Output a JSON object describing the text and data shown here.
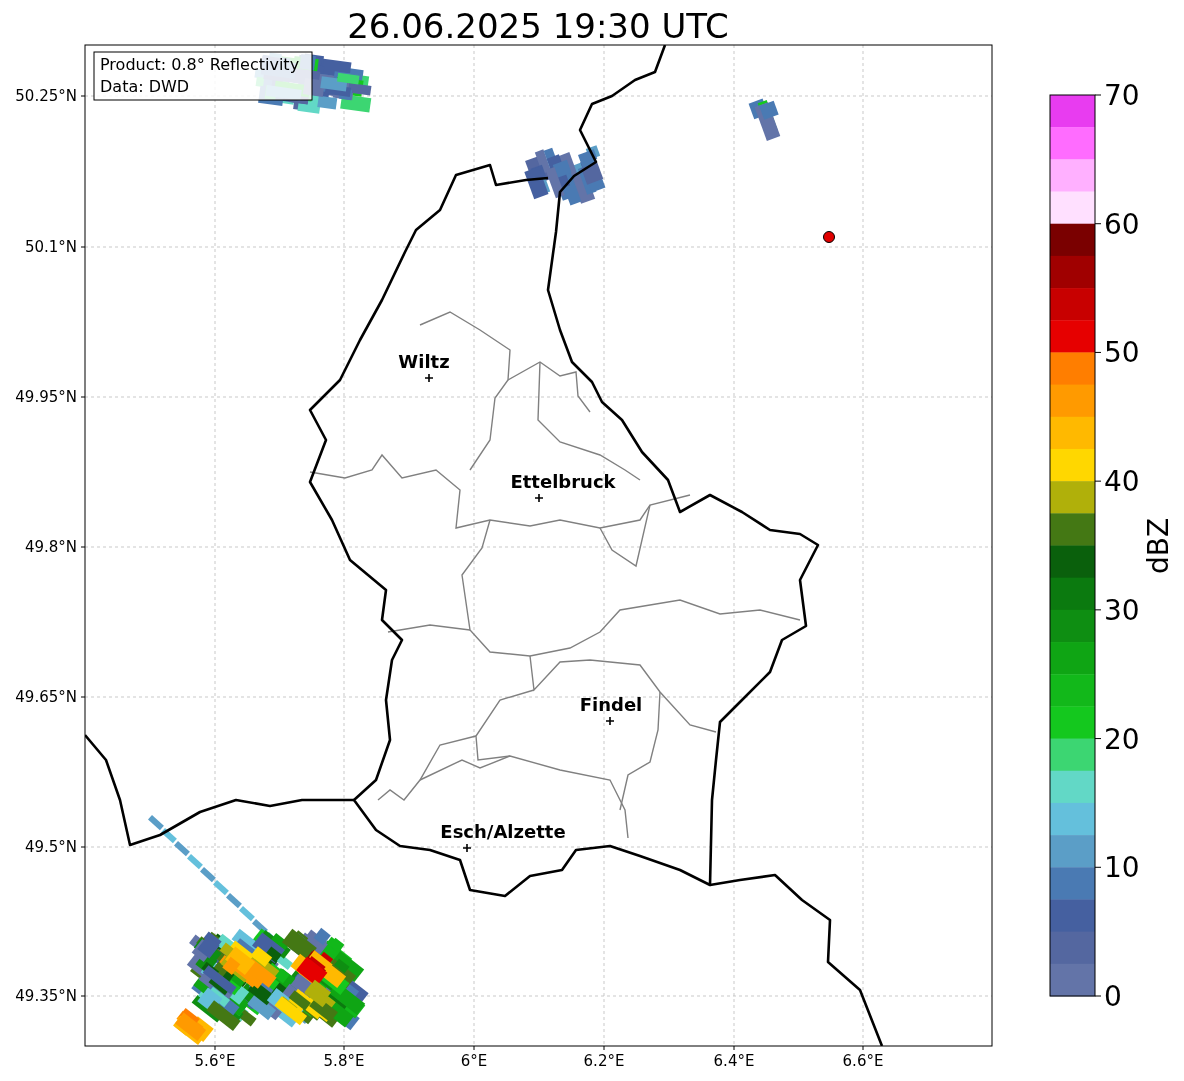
{
  "title": "26.06.2025 19:30 UTC",
  "info_box": [
    "Product: 0.8° Reflectivity",
    "Data: DWD"
  ],
  "map": {
    "x_ticks": [
      "5.6°E",
      "5.8°E",
      "6°E",
      "6.2°E",
      "6.4°E",
      "6.6°E"
    ],
    "y_ticks": [
      "50.25°N",
      "50.1°N",
      "49.95°N",
      "49.8°N",
      "49.65°N",
      "49.5°N",
      "49.35°N"
    ],
    "cities": [
      {
        "name": "Wiltz"
      },
      {
        "name": "Ettelbruck"
      },
      {
        "name": "Findel"
      },
      {
        "name": "Esch/Alzette"
      }
    ]
  },
  "colorbar": {
    "label": "dBZ",
    "ticks": [
      "70",
      "60",
      "50",
      "40",
      "30",
      "20",
      "10",
      "0"
    ],
    "levels": [
      {
        "color": "#e83cf0"
      },
      {
        "color": "#ff6cff"
      },
      {
        "color": "#ffb0ff"
      },
      {
        "color": "#ffe0ff"
      },
      {
        "color": "#7a0000"
      },
      {
        "color": "#a00000"
      },
      {
        "color": "#c80000"
      },
      {
        "color": "#e60000"
      },
      {
        "color": "#ff7e00"
      },
      {
        "color": "#ff9a00"
      },
      {
        "color": "#ffb900"
      },
      {
        "color": "#ffd700"
      },
      {
        "color": "#b0b00a"
      },
      {
        "color": "#447814"
      },
      {
        "color": "#0a600c"
      },
      {
        "color": "#0b7a0f"
      },
      {
        "color": "#0e8e12"
      },
      {
        "color": "#0fa514"
      },
      {
        "color": "#12b81a"
      },
      {
        "color": "#14c81e"
      },
      {
        "color": "#3cd672"
      },
      {
        "color": "#62d8c6"
      },
      {
        "color": "#64c0dc"
      },
      {
        "color": "#5b9ec7"
      },
      {
        "color": "#4a7ab3"
      },
      {
        "color": "#4560a0"
      },
      {
        "color": "#5467a0"
      },
      {
        "color": "#6374a8"
      }
    ]
  }
}
